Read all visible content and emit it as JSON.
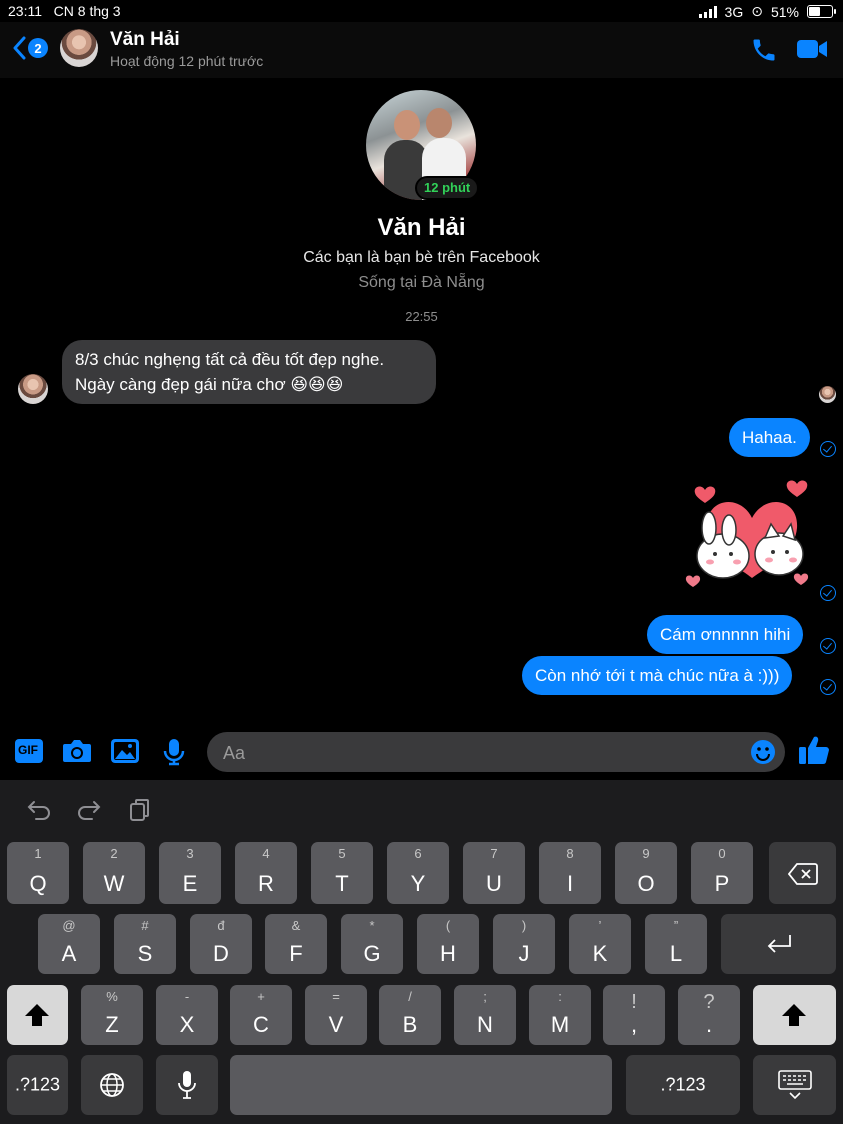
{
  "status_bar": {
    "time": "23:11",
    "date": "CN 8 thg 3",
    "network": "3G",
    "battery": "51%"
  },
  "header": {
    "back_badge": "2",
    "name": "Văn Hải",
    "status": "Hoạt động 12 phút trước"
  },
  "profile": {
    "active_badge": "12 phút",
    "name": "Văn Hải",
    "friends_text": "Các bạn là bạn bè trên Facebook",
    "location": "Sống tại Đà Nẵng"
  },
  "timestamp": "22:55",
  "messages": {
    "incoming": "8/3 chúc nghẹng tất cả đều tốt đẹp nghe. Ngày càng đẹp gái nữa chơ 😆😆😆",
    "out1": "Hahaa.",
    "out2": "Cám ơnnnnn hihi",
    "out3": "Còn nhớ tới t mà chúc nữa à :)))"
  },
  "composer": {
    "placeholder": "Aa",
    "gif_label": "GIF"
  },
  "keyboard": {
    "row1": [
      {
        "sub": "1",
        "main": "Q"
      },
      {
        "sub": "2",
        "main": "W"
      },
      {
        "sub": "3",
        "main": "E"
      },
      {
        "sub": "4",
        "main": "R"
      },
      {
        "sub": "5",
        "main": "T"
      },
      {
        "sub": "6",
        "main": "Y"
      },
      {
        "sub": "7",
        "main": "U"
      },
      {
        "sub": "8",
        "main": "I"
      },
      {
        "sub": "9",
        "main": "O"
      },
      {
        "sub": "0",
        "main": "P"
      }
    ],
    "row2": [
      {
        "sub": "@",
        "main": "A"
      },
      {
        "sub": "#",
        "main": "S"
      },
      {
        "sub": "đ",
        "main": "D"
      },
      {
        "sub": "&",
        "main": "F"
      },
      {
        "sub": "*",
        "main": "G"
      },
      {
        "sub": "(",
        "main": "H"
      },
      {
        "sub": ")",
        "main": "J"
      },
      {
        "sub": "’",
        "main": "K"
      },
      {
        "sub": "”",
        "main": "L"
      }
    ],
    "row3": [
      {
        "sub": "%",
        "main": "Z"
      },
      {
        "sub": "-",
        "main": "X"
      },
      {
        "sub": "+",
        "main": "C"
      },
      {
        "sub": "=",
        "main": "V"
      },
      {
        "sub": "/",
        "main": "B"
      },
      {
        "sub": ";",
        "main": "N"
      },
      {
        "sub": ":",
        "main": "M"
      },
      {
        "sub": "!",
        "main": ","
      },
      {
        "sub": "?",
        "main": "."
      }
    ],
    "numbers_label": ".?123"
  }
}
